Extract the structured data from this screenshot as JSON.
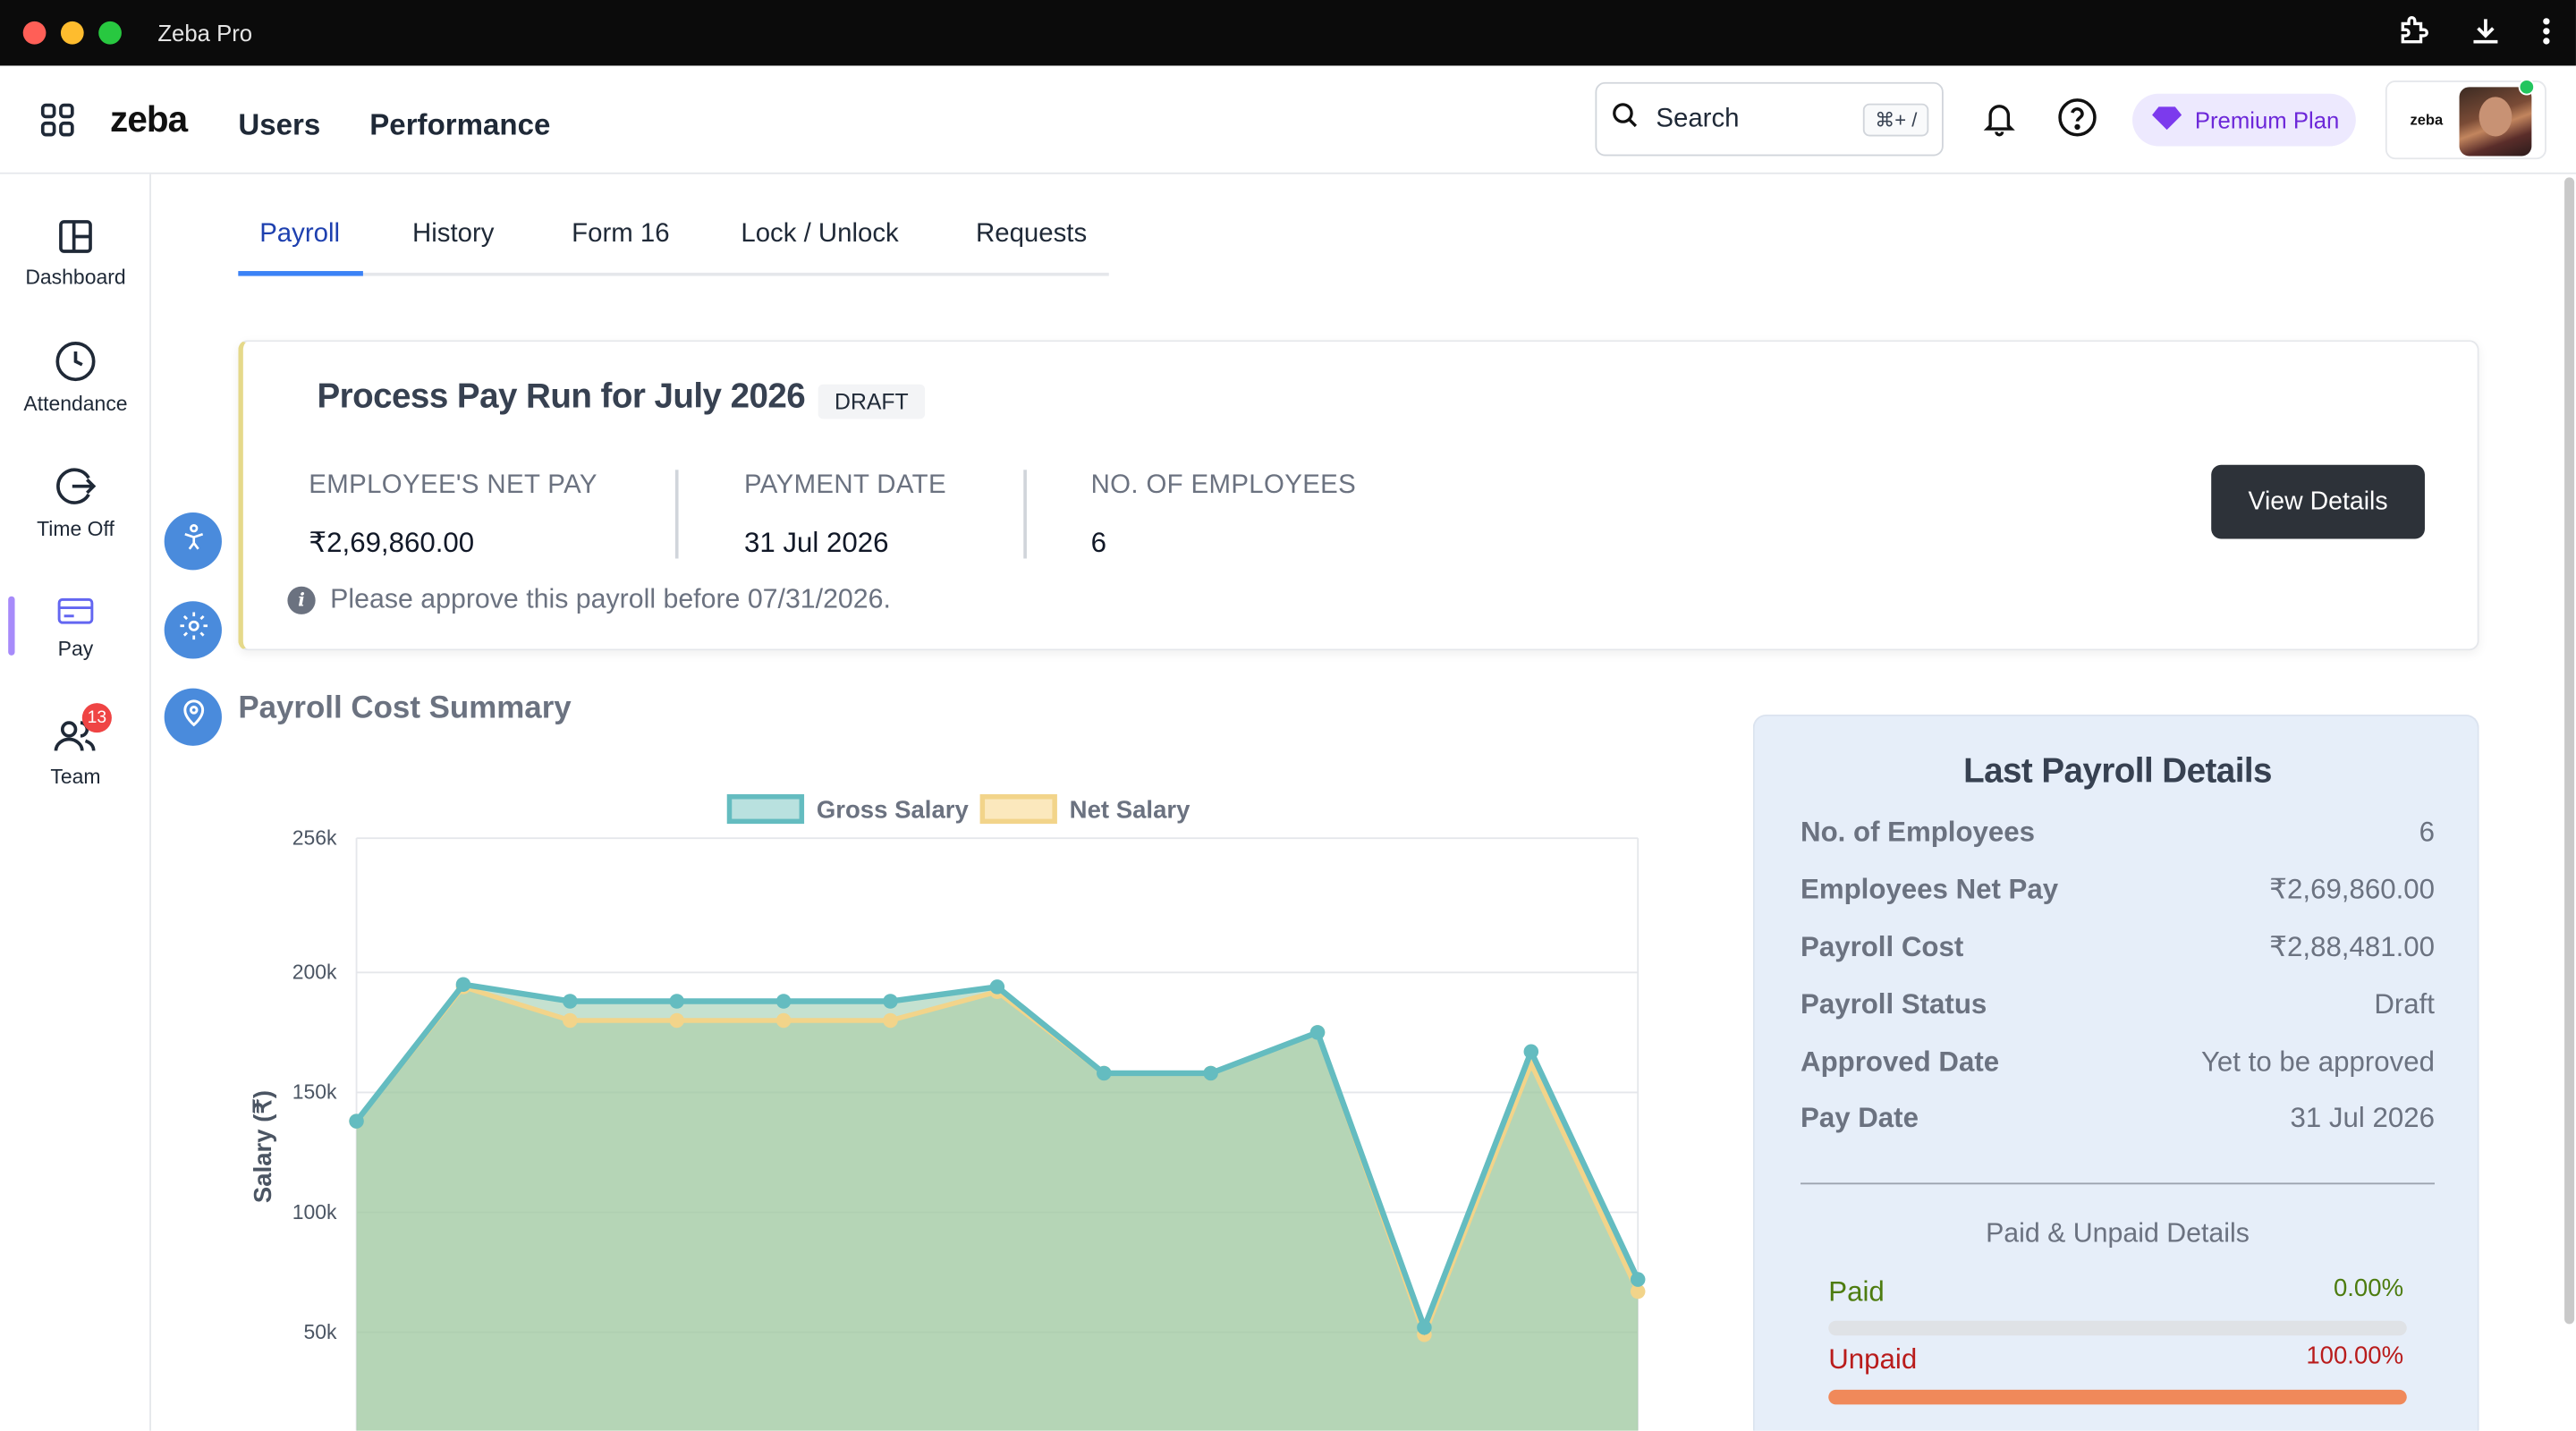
{
  "window": {
    "title": "Zeba Pro"
  },
  "header": {
    "logo": "zeba",
    "nav": [
      "Users",
      "Performance"
    ],
    "search_label": "Search",
    "search_shortcut": "⌘+ /",
    "premium_label": "Premium Plan",
    "profile_logo": "zeba"
  },
  "sidebar": {
    "items": [
      {
        "label": "Dashboard",
        "icon": "layout-icon"
      },
      {
        "label": "Attendance",
        "icon": "clock-icon"
      },
      {
        "label": "Time Off",
        "icon": "exit-icon"
      },
      {
        "label": "Pay",
        "icon": "card-icon",
        "active": true
      },
      {
        "label": "Team",
        "icon": "team-icon",
        "badge": "13"
      }
    ]
  },
  "tabs": [
    "Payroll",
    "History",
    "Form 16",
    "Lock / Unlock",
    "Requests"
  ],
  "payrun": {
    "title": "Process Pay Run for July 2026",
    "status": "DRAFT",
    "stats": [
      {
        "label": "EMPLOYEE'S NET PAY",
        "value": "₹2,69,860.00"
      },
      {
        "label": "PAYMENT DATE",
        "value": "31 Jul 2026"
      },
      {
        "label": "NO. OF EMPLOYEES",
        "value": "6"
      }
    ],
    "note": "Please approve this payroll before 07/31/2026.",
    "button": "View Details"
  },
  "summary": {
    "title": "Payroll Cost Summary"
  },
  "chart_data": {
    "type": "area",
    "ylabel": "Salary (₹)",
    "xlabel": "",
    "ylim": [
      0,
      256000
    ],
    "yticks": [
      "256k",
      "200k",
      "150k",
      "100k",
      "50k"
    ],
    "ytick_values": [
      256000,
      200000,
      150000,
      100000,
      50000
    ],
    "grid": true,
    "legend": "top-center",
    "series": [
      {
        "name": "Gross Salary",
        "color": "#64bcc0",
        "values": [
          138000,
          195000,
          188000,
          188000,
          188000,
          188000,
          194000,
          158000,
          158000,
          175000,
          52000,
          167000,
          72000
        ]
      },
      {
        "name": "Net Salary",
        "color": "#f2d48a",
        "values": [
          138000,
          194000,
          180000,
          180000,
          180000,
          180000,
          192000,
          158000,
          158000,
          175000,
          49000,
          162000,
          67000
        ]
      }
    ]
  },
  "last_payroll": {
    "title": "Last Payroll Details",
    "rows": [
      {
        "k": "No. of Employees",
        "v": "6"
      },
      {
        "k": "Employees Net Pay",
        "v": "₹2,69,860.00"
      },
      {
        "k": "Payroll Cost",
        "v": "₹2,88,481.00"
      },
      {
        "k": "Payroll Status",
        "v": "Draft"
      },
      {
        "k": "Approved Date",
        "v": "Yet to be approved"
      },
      {
        "k": "Pay Date",
        "v": "31 Jul 2026"
      }
    ],
    "paid_unpaid_title": "Paid & Unpaid Details",
    "paid": {
      "label": "Paid",
      "pct": "0.00%",
      "fraction": 0.0,
      "color": "#4d7c0f"
    },
    "unpaid": {
      "label": "Unpaid",
      "pct": "100.00%",
      "fraction": 1.0,
      "color": "#b91c1c",
      "bar": "#f0895a"
    }
  }
}
